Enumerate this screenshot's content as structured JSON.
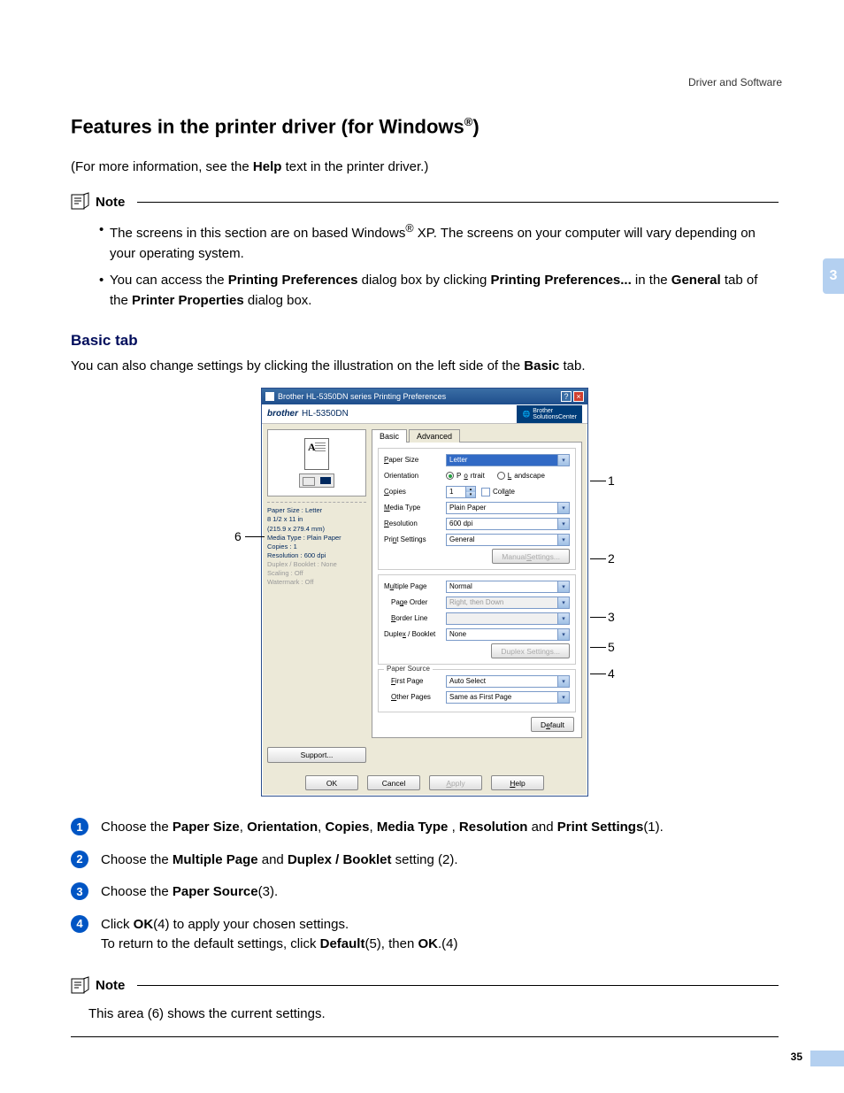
{
  "header": {
    "text": "Driver and Software"
  },
  "chapter": {
    "num": "3"
  },
  "page": {
    "title_pre": "Features in the printer driver (for Windows",
    "title_sup": "®",
    "title_post": ")",
    "intro_pre": "(For more information, see the ",
    "intro_bold": "Help",
    "intro_post": " text in the printer driver.)"
  },
  "note1": {
    "label": "Note",
    "b1_pre": "The screens in this section are on based Windows",
    "b1_sup": "®",
    "b1_post": " XP. The screens on your computer will vary depending on your operating system.",
    "b2_a": "You can access the ",
    "b2_b": "Printing Preferences",
    "b2_c": " dialog box by clicking ",
    "b2_d": "Printing Preferences...",
    "b2_e": " in the ",
    "b2_f": "General",
    "b2_g": " tab of the ",
    "b2_h": "Printer Properties",
    "b2_i": " dialog box."
  },
  "h2": "Basic tab",
  "subdesc_a": "You can also change settings by clicking the illustration on the left side of the ",
  "subdesc_b": "Basic",
  "subdesc_c": " tab.",
  "dialog": {
    "title": "Brother HL-5350DN series Printing Preferences",
    "brand": "brother",
    "model": "HL-5350DN",
    "solutions_a": "Brother",
    "solutions_b": "SolutionsCenter",
    "tabs": {
      "basic": "Basic",
      "advanced": "Advanced"
    },
    "status": {
      "s1": "Paper Size : Letter",
      "s2": "8 1/2 x 11 in",
      "s3": "(215.9 x 279.4 mm)",
      "s4": "Media Type : Plain Paper",
      "s5": "Copies : 1",
      "s6": "Resolution : 600 dpi",
      "s7": "Duplex / Booklet : None",
      "s8": "Scaling : Off",
      "s9": "Watermark : Off"
    },
    "labels": {
      "paper_size": "Paper Size",
      "orientation": "Orientation",
      "copies": "Copies",
      "media_type": "Media Type",
      "resolution": "Resolution",
      "print_settings": "Print Settings",
      "multiple_page": "Multiple Page",
      "page_order": "Page Order",
      "border_line": "Border Line",
      "duplex_booklet": "Duplex / Booklet",
      "paper_source": "Paper Source",
      "first_page": "First Page",
      "other_pages": "Other Pages"
    },
    "values": {
      "paper_size": "Letter",
      "portrait": "Portrait",
      "landscape": "Landscape",
      "copies": "1",
      "collate": "Collate",
      "media_type": "Plain Paper",
      "resolution": "600 dpi",
      "print_settings": "General",
      "manual_settings": "Manual Settings...",
      "multiple_page": "Normal",
      "page_order": "Right, then Down",
      "border_line": "",
      "duplex_booklet": "None",
      "duplex_settings": "Duplex Settings...",
      "first_page": "Auto Select",
      "other_pages": "Same as First Page",
      "default": "Default"
    },
    "buttons": {
      "support": "Support...",
      "ok": "OK",
      "cancel": "Cancel",
      "apply": "Apply",
      "help": "Help"
    }
  },
  "callouts": {
    "c1": "1",
    "c2": "2",
    "c3": "3",
    "c4": "4",
    "c5": "5",
    "c6": "6"
  },
  "list": {
    "n1": "1",
    "n2": "2",
    "n3": "3",
    "n4": "4",
    "i1_a": "Choose the ",
    "i1_b": "Paper Size",
    "i1_c": ", ",
    "i1_d": "Orientation",
    "i1_e": ", ",
    "i1_f": "Copies",
    "i1_g": ", ",
    "i1_h": "Media Type",
    "i1_i": " , ",
    "i1_j": "Resolution",
    "i1_k": " and ",
    "i1_l": "Print Settings",
    "i1_m": "(1).",
    "i2_a": "Choose the ",
    "i2_b": "Multiple Page",
    "i2_c": " and ",
    "i2_d": "Duplex / Booklet",
    "i2_e": " setting (2).",
    "i3_a": "Choose the ",
    "i3_b": "Paper Source",
    "i3_c": "(3).",
    "i4_a": "Click ",
    "i4_b": "OK",
    "i4_c": "(4) to apply your chosen settings.",
    "i4_d": "To return to the default settings, click ",
    "i4_e": "Default",
    "i4_f": "(5), then ",
    "i4_g": "OK",
    "i4_h": ".(4)"
  },
  "note2": {
    "label": "Note",
    "text": "This area (6) shows the current settings."
  },
  "pagenum": "35"
}
